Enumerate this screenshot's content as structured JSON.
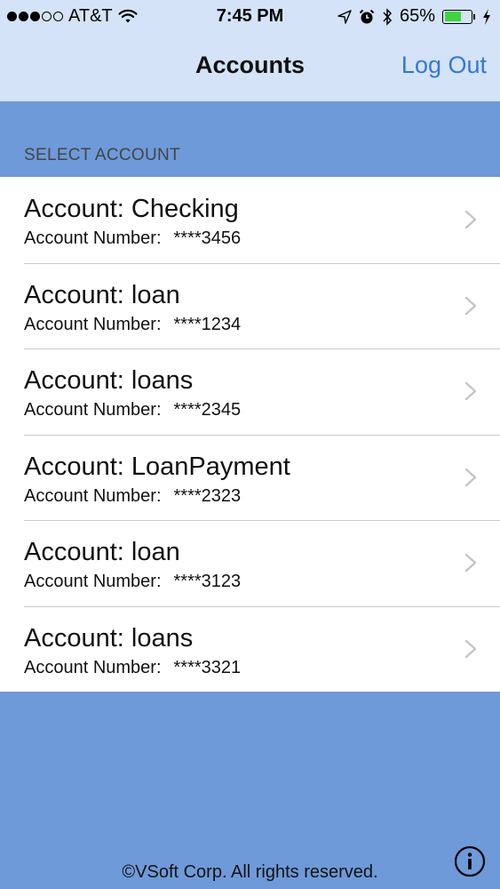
{
  "status_bar": {
    "carrier": "AT&T",
    "time": "7:45 PM",
    "battery_percent": "65%",
    "battery_level": 0.65,
    "signal_bars_filled": 3,
    "signal_bars_total": 5,
    "icons": [
      "wifi-icon",
      "location-arrow-icon",
      "alarm-clock-icon",
      "bluetooth-icon",
      "charging-bolt-icon"
    ]
  },
  "nav": {
    "title": "Accounts",
    "logout_label": "Log Out"
  },
  "section": {
    "header": "SELECT ACCOUNT"
  },
  "accounts": [
    {
      "title": "Account: Checking",
      "number_label": "Account Number:",
      "number": "****3456"
    },
    {
      "title": "Account: loan",
      "number_label": "Account Number:",
      "number": "****1234"
    },
    {
      "title": "Account: loans",
      "number_label": "Account Number:",
      "number": "****2345"
    },
    {
      "title": "Account: LoanPayment",
      "number_label": "Account Number:",
      "number": "****2323"
    },
    {
      "title": "Account: loan",
      "number_label": "Account Number:",
      "number": "****3123"
    },
    {
      "title": "Account: loans",
      "number_label": "Account Number:",
      "number": "****3321"
    }
  ],
  "footer": {
    "copyright": "©VSoft Corp. All rights reserved."
  },
  "colors": {
    "background": "#6e9ad9",
    "nav_background": "#d4e3f7",
    "link": "#3478d6",
    "battery": "#3fd33f"
  }
}
